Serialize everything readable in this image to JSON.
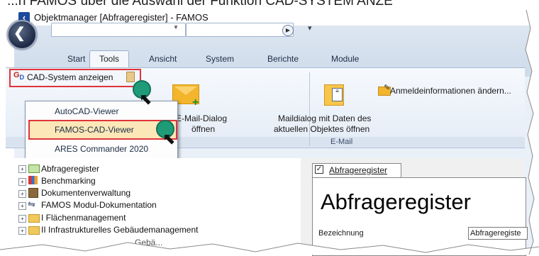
{
  "caption": "...n FAMOS über die Auswahl der Funktion CAD-SYSTEM ANZE",
  "window": {
    "title": "Objektmanager [Abfrageregister] - FAMOS"
  },
  "tabs": [
    "Start",
    "Tools",
    "Ansicht",
    "System",
    "Berichte",
    "Module"
  ],
  "ribbon": {
    "cad_system_label": "CAD-System anzeigen",
    "email_dialog_line1": "n E-Mail-Dialog",
    "email_dialog_line2": "öffnen",
    "maildialog_line1": "Maildialog mit Daten des",
    "maildialog_line2": "aktuellen Objektes öffnen",
    "anmelde_label": "Anmeldeinformationen ändern...",
    "group_email": "E-Mail"
  },
  "menu": {
    "items": [
      "AutoCAD-Viewer",
      "FAMOS-CAD-Viewer",
      "ARES Commander 2020"
    ],
    "selected": "FAMOS-CAD-Viewer"
  },
  "tree": {
    "items": [
      "Abfrageregister",
      "Benchmarking",
      "Dokumentenverwaltung",
      "FAMOS Modul-Dokumentation",
      "I  Flächenmanagement",
      "II Infrastrukturelles Gebäudemanagement",
      "Gebä..."
    ]
  },
  "detail": {
    "tab_label": "Abfrageregister",
    "heading": "Abfrageregister",
    "field_label": "Bezeichnung",
    "field_value": "Abfrageregiste"
  },
  "colors": {
    "highlight_red": "#e0333b",
    "cursor_dot": "#1f9b78",
    "menu_selected": "#fbe7b8"
  }
}
